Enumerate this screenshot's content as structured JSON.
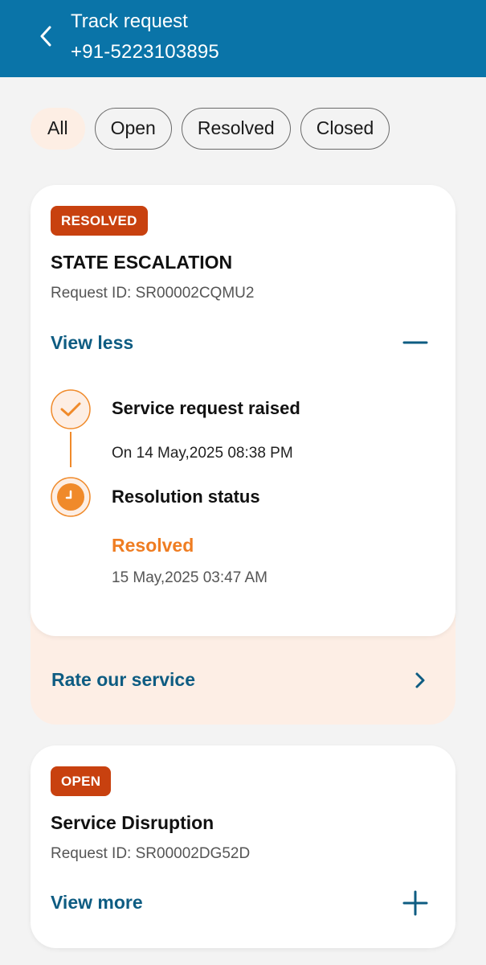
{
  "header": {
    "title": "Track request",
    "phone": "+91-5223103895"
  },
  "filters": [
    {
      "label": "All",
      "active": true
    },
    {
      "label": "Open",
      "active": false
    },
    {
      "label": "Resolved",
      "active": false
    },
    {
      "label": "Closed",
      "active": false
    }
  ],
  "requests": [
    {
      "status_badge": "RESOLVED",
      "title": "STATE ESCALATION",
      "request_id": "Request ID: SR00002CQMU2",
      "toggle_label": "View less",
      "timeline": {
        "raised_title": "Service request raised",
        "raised_date": "On 14 May,2025 08:38 PM",
        "resolution_title": "Resolution status",
        "resolution_status": "Resolved",
        "resolution_date": "15 May,2025 03:47 AM"
      },
      "rate_label": "Rate our service"
    },
    {
      "status_badge": "OPEN",
      "title": "Service Disruption",
      "request_id": "Request ID: SR00002DG52D",
      "toggle_label": "View more"
    }
  ],
  "icons": {
    "back": "chevron-left-icon",
    "collapse": "minus-icon",
    "expand": "plus-icon",
    "raised": "check-circle-icon",
    "resolution": "clock-icon",
    "rate": "chevron-right-icon"
  },
  "colors": {
    "header_bg": "#0a74a8",
    "badge_bg": "#c8410f",
    "link": "#0e5c82",
    "accent_orange": "#ef7d22",
    "rate_bg": "#fdeee5",
    "active_chip_bg": "#fdeee4"
  }
}
